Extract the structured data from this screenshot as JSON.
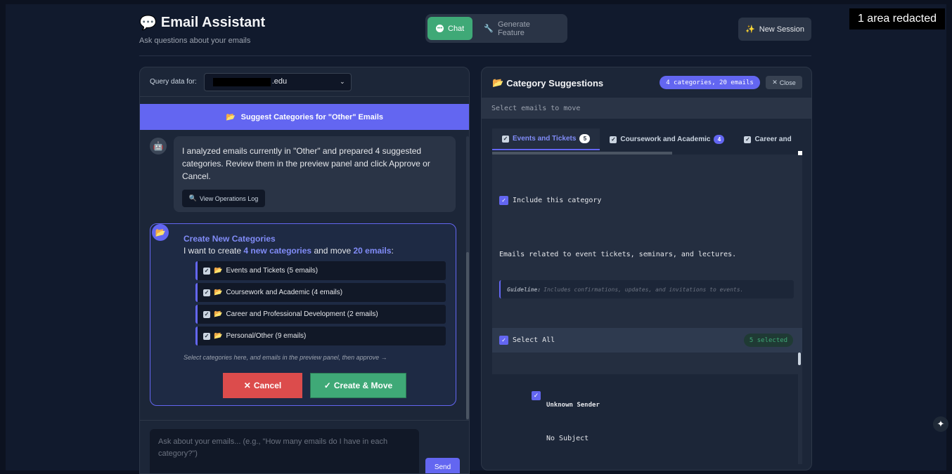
{
  "overlay": {
    "redaction_label": "1 area redacted"
  },
  "header": {
    "title": "Email Assistant",
    "title_icon": "speech-bubble-icon",
    "subtitle": "Ask questions about your emails",
    "modes": [
      {
        "label": "Chat",
        "icon": "chat-icon",
        "active": true
      },
      {
        "label": "Generate Feature",
        "icon": "wrench-icon",
        "active": false
      }
    ],
    "new_session_label": "New Session"
  },
  "left": {
    "query_label": "Query data for:",
    "query_value_suffix": ".edu",
    "suggest_button": "Suggest Categories for \"Other\" Emails",
    "assistant_message": "I analyzed emails currently in \"Other\" and prepared 4 suggested categories. Review them in the preview panel and click Approve or Cancel.",
    "log_button": "View Operations Log",
    "card": {
      "title": "Create New Categories",
      "text_before": "I want to create ",
      "text_count_categories": "4 new categories",
      "text_mid": " and move ",
      "text_count_emails": "20 emails",
      "text_after": ":",
      "categories": [
        "Events and Tickets (5 emails)",
        "Coursework and Academic (4 emails)",
        "Career and Professional Development (2 emails)",
        "Personal/Other (9 emails)"
      ],
      "hint": "Select categories here, and emails in the preview panel, then approve →",
      "cancel_label": "Cancel",
      "create_label": "Create & Move"
    },
    "input_placeholder": "Ask about your emails... (e.g., \"How many emails do I have in each category?\")",
    "send_label": "Send"
  },
  "right": {
    "title": "Category Suggestions",
    "badge": "4 categories, 20 emails",
    "close_label": "Close",
    "subbar": "Select emails to move",
    "tabs": [
      {
        "label": "Events and Tickets",
        "count": "5",
        "active": true
      },
      {
        "label": "Coursework and Academic",
        "count": "4",
        "active": false
      },
      {
        "label": "Career and",
        "count": "",
        "active": false
      }
    ],
    "include_label": "Include this category",
    "description": "Emails related to event tickets, seminars, and lectures.",
    "guideline_label": "Guideline:",
    "guideline_text": "Includes confirmations, updates, and invitations to events.",
    "select_all_label": "Select All",
    "selected_badge": "5 selected",
    "email": {
      "sender": "Unknown Sender",
      "subject": "No Subject"
    }
  },
  "colors": {
    "accent": "#6366f1",
    "success": "#3fa977",
    "danger": "#dc4c4c",
    "background": "#111a2d"
  }
}
